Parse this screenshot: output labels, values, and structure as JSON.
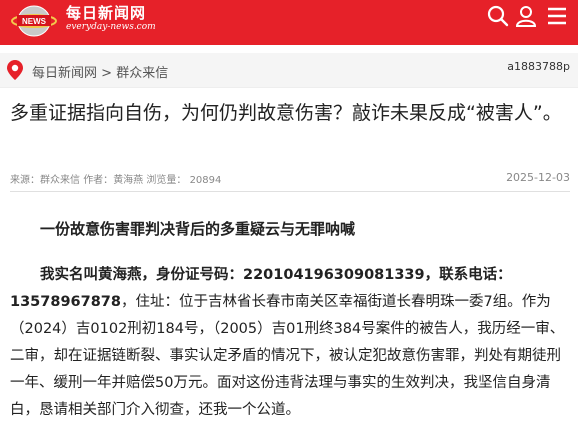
{
  "header": {
    "logo_text": "NEWS",
    "site_name": "每日新闻网",
    "site_url": "everyday-news.com",
    "icons": [
      "search-icon",
      "user-icon",
      "menu-icon"
    ]
  },
  "breadcrumb": {
    "home": "每日新闻网",
    "separator": ">",
    "section": "群众来信",
    "article_id": "a1883788p"
  },
  "article": {
    "title": "多重证据指向自伤，为何仍判故意伤害？敲诈未果反成“被害人”。",
    "meta": {
      "source_label": "来源：",
      "source": "群众来信",
      "author_label": "作者：",
      "author": "黄海燕",
      "views_label": "浏览量：",
      "views": "20894",
      "date": "2025-12-03"
    },
    "subheading": "一份故意伤害罪判决背后的多重疑云与无罪呐喊",
    "body": {
      "bold_lead": "我实名叫黄海燕，身份证号码：220104196309081339，联系电话：13578967878",
      "rest": "，住址：位于吉林省长春市南关区幸福街道长春明珠一委7组。作为（2024）吉0102刑初184号，（2005）吉01刑终384号案件的被告人，我历经一审、二审，却在证据链断裂、事实认定矛盾的情况下，被认定犯故意伤害罪，判处有期徒刑一年、缓刑一年并赔偿50万元。面对这份违背法理与事实的生效判决，我坚信自身清白，恳请相关部门介入彻查，还我一个公道。"
    }
  },
  "colors": {
    "brand_red": "#e62129",
    "crumb_bg": "#f5f5f5",
    "pin_red": "#e62129"
  }
}
